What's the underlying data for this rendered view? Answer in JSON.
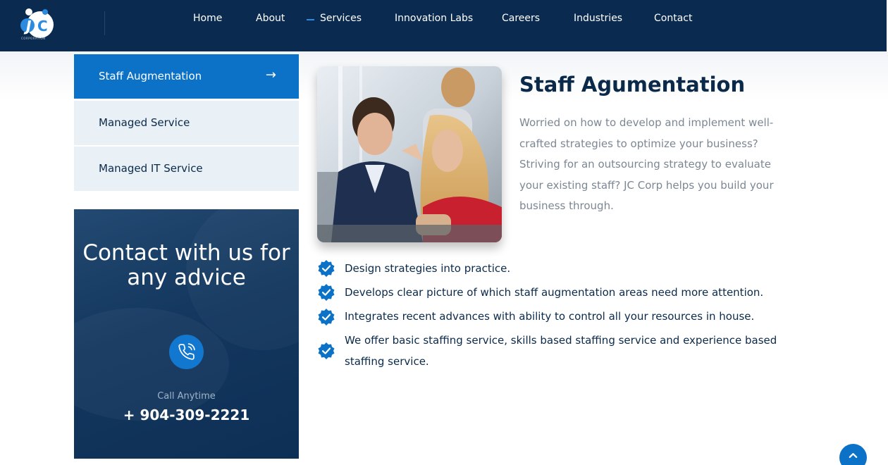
{
  "header": {
    "logo_text": "CORPORATION",
    "nav": [
      {
        "label": "Home"
      },
      {
        "label": "About"
      },
      {
        "label": "Services"
      },
      {
        "label": "Innovation Labs"
      },
      {
        "label": "Careers"
      },
      {
        "label": "Industries"
      },
      {
        "label": "Contact"
      }
    ]
  },
  "sidebar": {
    "items": [
      {
        "label": "Staff Augmentation",
        "arrow": "→",
        "active": true
      },
      {
        "label": "Managed Service",
        "active": false
      },
      {
        "label": "Managed IT Service",
        "active": false
      }
    ]
  },
  "contact_card": {
    "title": "Contact with us for any advice",
    "icon": "phone-call-icon",
    "call_label": "Call Anytime",
    "phone": "+ 904-309-2221"
  },
  "main": {
    "title": "Staff Agumentation",
    "description": "Worried on how to develop and implement well-crafted strategies to optimize your business? Striving for an outsourcing strategy to evaluate your existing staff? JC Corp helps you build your business through.",
    "bullets": [
      "Design strategies into practice.",
      "Develops clear picture of which staff augmentation areas need more attention.",
      "Integrates recent advances with ability to control all your resources in house.",
      "We offer basic staffing service, skills based staffing service and experience based staffing service."
    ]
  },
  "colors": {
    "header_bg": "#0a2b4f",
    "accent": "#0b72c7",
    "sidebar_bg": "#e9f0f6",
    "text_dark": "#0b2a4a",
    "text_muted": "#7c8794"
  },
  "back_to_top": {
    "icon": "chevron-up-icon"
  }
}
